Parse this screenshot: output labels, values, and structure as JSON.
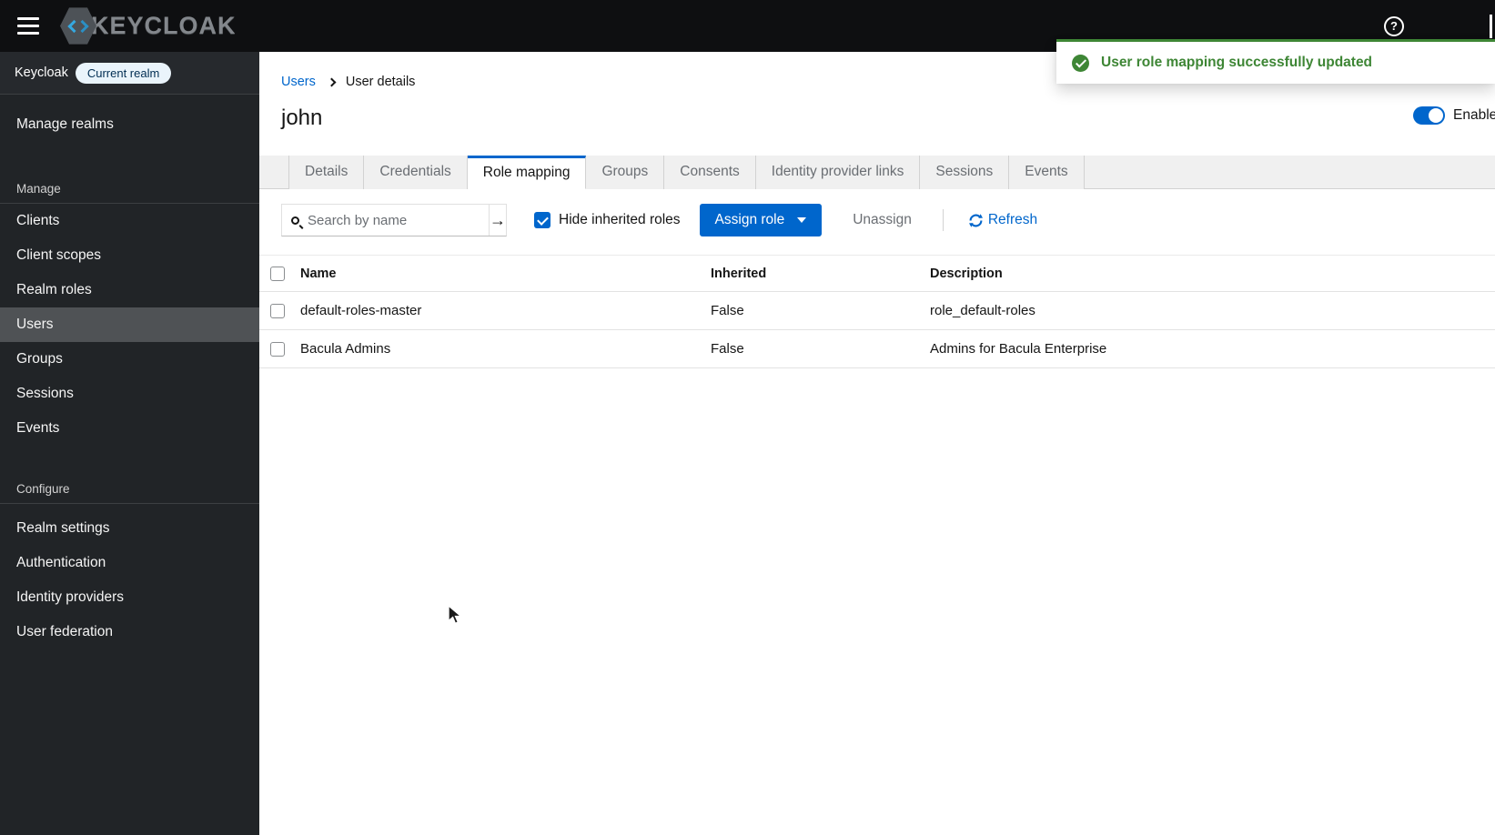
{
  "topbar": {
    "brand": "KEYCLOAK",
    "help_glyph": "?"
  },
  "sidebar": {
    "realm_label": "Keycloak",
    "realm_badge": "Current realm",
    "manage_realms": "Manage realms",
    "sections": [
      {
        "title": "Manage",
        "items": [
          "Clients",
          "Client scopes",
          "Realm roles",
          "Users",
          "Groups",
          "Sessions",
          "Events"
        ],
        "selected": "Users"
      },
      {
        "title": "Configure",
        "items": [
          "Realm settings",
          "Authentication",
          "Identity providers",
          "User federation"
        ]
      }
    ]
  },
  "breadcrumb": {
    "parent": "Users",
    "current": "User details"
  },
  "page": {
    "title": "john",
    "enabled_label": "Enabled"
  },
  "tabs": {
    "active": "Role mapping",
    "items": [
      "Details",
      "Credentials",
      "Role mapping",
      "Groups",
      "Consents",
      "Identity provider links",
      "Sessions",
      "Events"
    ]
  },
  "toolbar": {
    "search_placeholder": "Search by name",
    "search_submit_glyph": "→",
    "hide_inherited_label": "Hide inherited roles",
    "hide_inherited_checked": true,
    "assign_role_label": "Assign role",
    "unassign_label": "Unassign",
    "refresh_label": "Refresh"
  },
  "table": {
    "headers": {
      "name": "Name",
      "inherited": "Inherited",
      "description": "Description"
    },
    "rows": [
      {
        "name": "default-roles-master",
        "inherited": "False",
        "description": "role_default-roles"
      },
      {
        "name": "Bacula Admins",
        "inherited": "False",
        "description": "Admins for Bacula Enterprise"
      }
    ]
  },
  "toast": {
    "message": "User role mapping successfully updated"
  },
  "colors": {
    "accent": "#0066cc",
    "success": "#3e8635",
    "topbar": "#0e0f11",
    "sidebar": "#212427"
  }
}
